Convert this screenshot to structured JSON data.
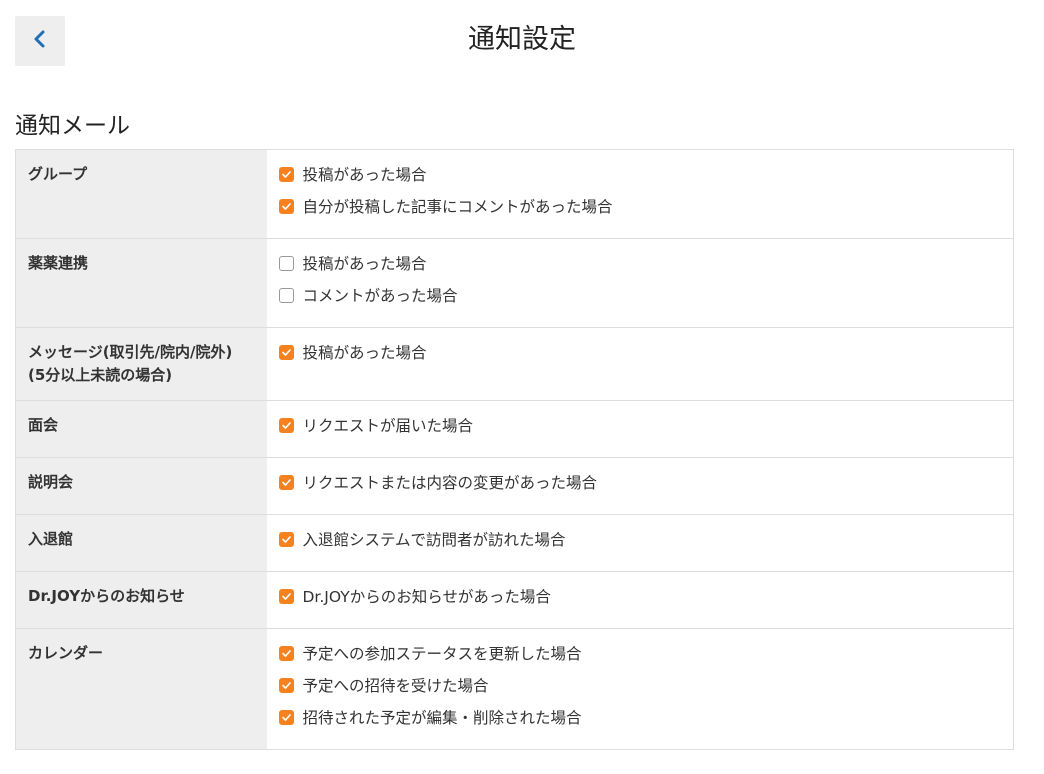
{
  "header": {
    "title": "通知設定",
    "back_icon": "chevron-left-icon"
  },
  "section": {
    "title": "通知メール"
  },
  "colors": {
    "accent": "#f5821f",
    "back_chevron": "#1f6fb5",
    "category_bg": "#eeeeee",
    "border": "#dddddd"
  },
  "rows": [
    {
      "category": "グループ",
      "options": [
        {
          "label": "投稿があった場合",
          "checked": true
        },
        {
          "label": "自分が投稿した記事にコメントがあった場合",
          "checked": true
        }
      ]
    },
    {
      "category": "薬薬連携",
      "options": [
        {
          "label": "投稿があった場合",
          "checked": false
        },
        {
          "label": "コメントがあった場合",
          "checked": false
        }
      ]
    },
    {
      "category": "メッセージ(取引先/院内/院外)(5分以上未読の場合)",
      "options": [
        {
          "label": "投稿があった場合",
          "checked": true
        }
      ]
    },
    {
      "category": "面会",
      "options": [
        {
          "label": "リクエストが届いた場合",
          "checked": true
        }
      ]
    },
    {
      "category": "説明会",
      "options": [
        {
          "label": "リクエストまたは内容の変更があった場合",
          "checked": true
        }
      ]
    },
    {
      "category": "入退館",
      "options": [
        {
          "label": "入退館システムで訪問者が訪れた場合",
          "checked": true
        }
      ]
    },
    {
      "category": "Dr.JOYからのお知らせ",
      "options": [
        {
          "label": "Dr.JOYからのお知らせがあった場合",
          "checked": true
        }
      ]
    },
    {
      "category": "カレンダー",
      "options": [
        {
          "label": "予定への参加ステータスを更新した場合",
          "checked": true
        },
        {
          "label": "予定への招待を受けた場合",
          "checked": true
        },
        {
          "label": "招待された予定が編集・削除された場合",
          "checked": true
        }
      ]
    }
  ]
}
